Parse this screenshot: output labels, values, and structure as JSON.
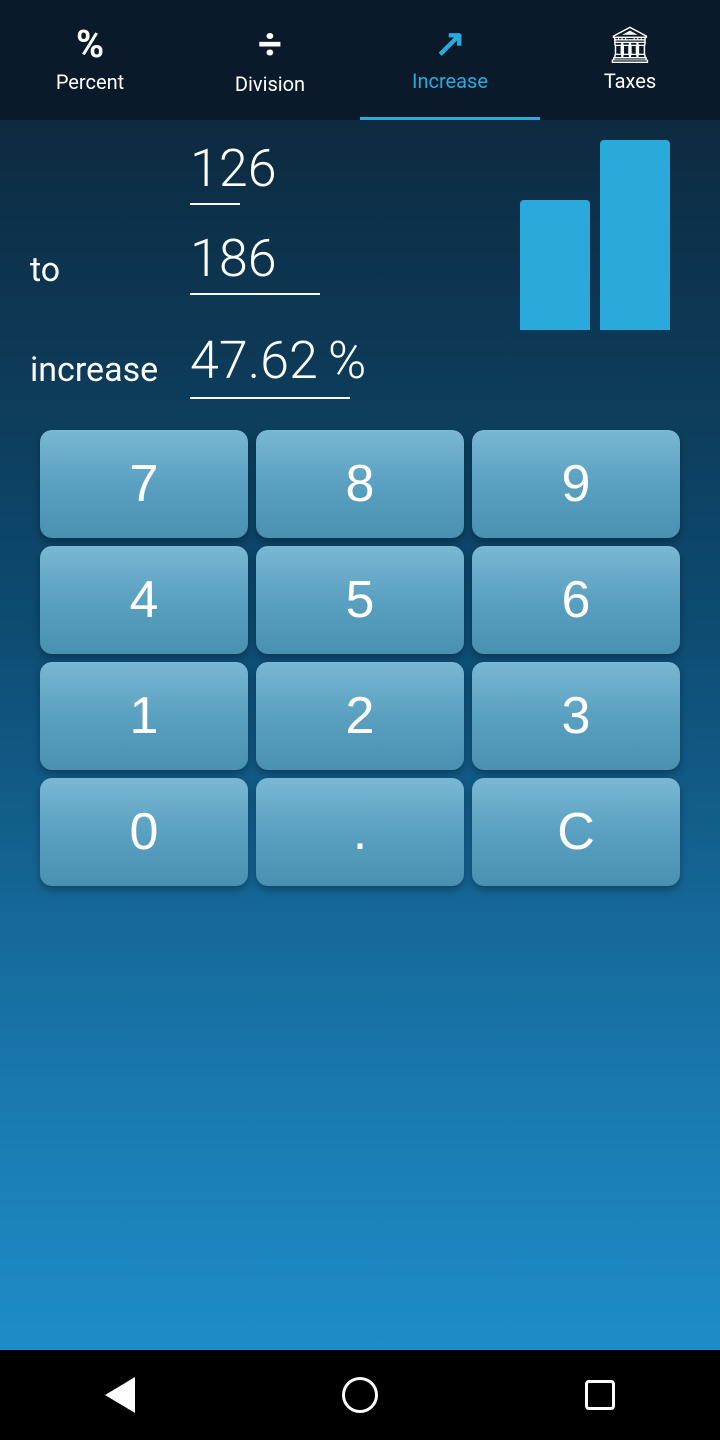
{
  "nav": {
    "items": [
      {
        "id": "percent",
        "label": "Percent",
        "icon": "icon-percent",
        "active": false
      },
      {
        "id": "division",
        "label": "Division",
        "icon": "icon-division",
        "active": false
      },
      {
        "id": "increase",
        "label": "Increase",
        "icon": "icon-increase",
        "active": true
      },
      {
        "id": "taxes",
        "label": "Taxes",
        "icon": "icon-taxes",
        "active": false
      }
    ]
  },
  "display": {
    "from_value": "126",
    "to_label": "to",
    "to_value": "186",
    "increase_label": "increase",
    "result_value": "47.62",
    "result_percent": "%"
  },
  "keypad": {
    "buttons": [
      {
        "label": "7",
        "id": "key-7"
      },
      {
        "label": "8",
        "id": "key-8"
      },
      {
        "label": "9",
        "id": "key-9"
      },
      {
        "label": "4",
        "id": "key-4"
      },
      {
        "label": "5",
        "id": "key-5"
      },
      {
        "label": "6",
        "id": "key-6"
      },
      {
        "label": "1",
        "id": "key-1"
      },
      {
        "label": "2",
        "id": "key-2"
      },
      {
        "label": "3",
        "id": "key-3"
      },
      {
        "label": "0",
        "id": "key-0"
      },
      {
        "label": ".",
        "id": "key-dot"
      },
      {
        "label": "C",
        "id": "key-clear"
      }
    ]
  },
  "chart": {
    "bar1_height": 130,
    "bar2_height": 190
  },
  "bottom_nav": {
    "back_label": "back",
    "home_label": "home",
    "recents_label": "recents"
  }
}
